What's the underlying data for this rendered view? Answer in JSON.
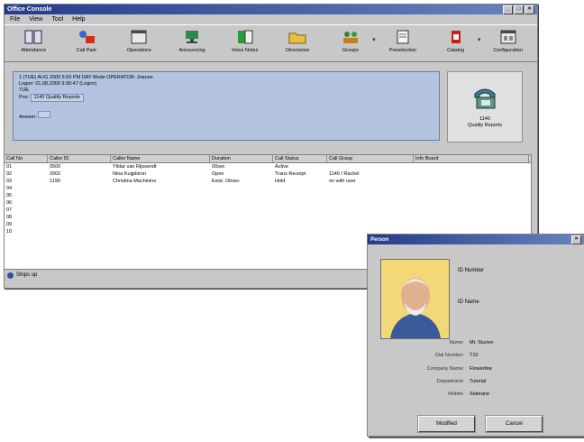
{
  "window": {
    "title": "Office Console",
    "btn_min": "_",
    "btn_max": "□",
    "btn_close": "×"
  },
  "menu": [
    "File",
    "View",
    "Tool",
    "Help"
  ],
  "toolbar": [
    {
      "label": "Attendance",
      "icon": "two-panel-icon"
    },
    {
      "label": "Call Park",
      "icon": "park-icon"
    },
    {
      "label": "Operations",
      "icon": "window-icon"
    },
    {
      "label": "Announcing",
      "icon": "network-icon"
    },
    {
      "label": "Voice Notes",
      "icon": "notebook-icon"
    },
    {
      "label": "Directories",
      "icon": "folder-icon"
    },
    {
      "label": "Groups",
      "icon": "group-icon"
    },
    {
      "label": "Preselection",
      "icon": "page-icon"
    },
    {
      "label": "Catalog",
      "icon": "catalog-icon"
    },
    {
      "label": "Configuration",
      "icon": "config-icon"
    }
  ],
  "info": {
    "line1": "1 (TUE) AUG 2000  5:55 PM  DAY Mode      OPERATOR: Joanne",
    "line2": "Logon: 01.08.2000 9:30:47 (Logon)",
    "line3": "TUE",
    "pos_label": "Pos:",
    "pos_value": "1140 Quality Reports",
    "answer_label": "Answer:",
    "phone_label_1": "1140",
    "phone_label_2": "Quality Reports"
  },
  "grid": {
    "columns": [
      "Call No",
      "Caller ID",
      "Caller Name",
      "Duration",
      "Call Status",
      "Call Group",
      "Info Board"
    ],
    "rows": [
      [
        "01",
        "0500",
        "Ylidar van Rijssendt",
        "00sec",
        "Active",
        "",
        ""
      ],
      [
        "02",
        "2002",
        "Nina Kuijpkiron",
        "Open",
        "Trans Receipt",
        "1140 / Rachel",
        ""
      ],
      [
        "03",
        "1199",
        "Christina Machinino",
        "Exist. Ohsec",
        "Hold",
        "on with user",
        ""
      ],
      [
        "04",
        "",
        "",
        "",
        "",
        "",
        ""
      ],
      [
        "05",
        "",
        "",
        "",
        "",
        "",
        ""
      ],
      [
        "06",
        "",
        "",
        "",
        "",
        "",
        ""
      ],
      [
        "07",
        "",
        "",
        "",
        "",
        "",
        ""
      ],
      [
        "08",
        "",
        "",
        "",
        "",
        "",
        ""
      ],
      [
        "09",
        "",
        "",
        "",
        "",
        "",
        ""
      ],
      [
        "10",
        "",
        "",
        "",
        "",
        "",
        ""
      ]
    ]
  },
  "status": {
    "text": "Ships up"
  },
  "dialog": {
    "title": "Person",
    "id_number": "ID Number",
    "id_name": "ID Name",
    "fields": [
      {
        "k": "Name:",
        "v": "Mr. Sturien"
      },
      {
        "k": "Dial Number:",
        "v": "T10"
      },
      {
        "k": "Company Name:",
        "v": "Flowerline"
      },
      {
        "k": "Department:",
        "v": "Tutorial"
      },
      {
        "k": "Mobile:",
        "v": "Siderane"
      }
    ],
    "ok_label": "Modified",
    "cancel_label": "Cancel"
  }
}
